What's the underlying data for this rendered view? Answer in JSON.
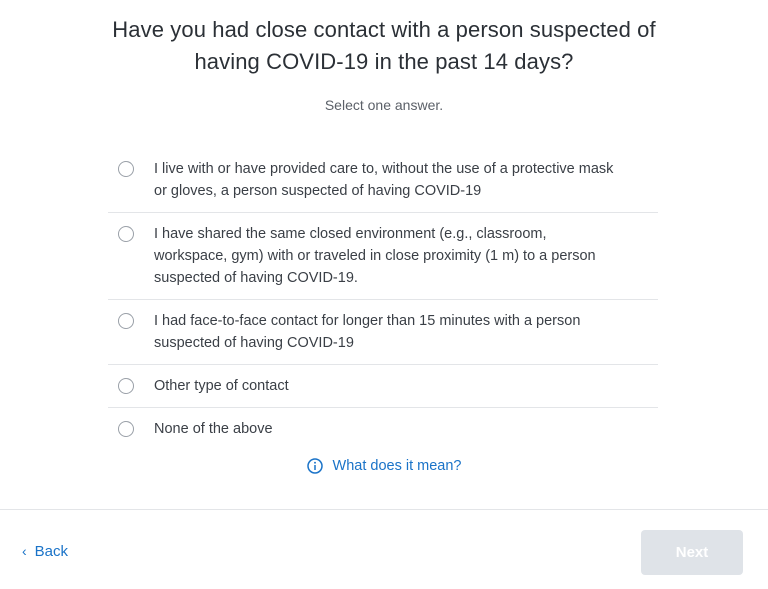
{
  "question": {
    "line1": "Have you had close contact with a person suspected of",
    "line2": "having COVID-19 in the past 14 days?"
  },
  "hint": "Select one answer.",
  "options": [
    {
      "label": "I live with or have provided care to, without the use of a protective mask or gloves, a person suspected of having COVID-19",
      "selected": false
    },
    {
      "label": "I have shared the same closed environment (e.g., classroom, workspace, gym) with or traveled in close proximity (1 m) to a person suspected of having COVID-19.",
      "selected": false
    },
    {
      "label": "I had face-to-face contact for longer than 15 minutes with a person suspected of having COVID-19",
      "selected": false
    },
    {
      "label": "Other type of contact",
      "selected": false
    },
    {
      "label": "None of the above",
      "selected": false
    }
  ],
  "help_link": "What does it mean?",
  "nav": {
    "back_label": "Back",
    "next_label": "Next",
    "next_enabled": false
  },
  "colors": {
    "link": "#1a73c8",
    "next_disabled_bg": "#dfe3e8",
    "divider": "#e3e5e8"
  }
}
